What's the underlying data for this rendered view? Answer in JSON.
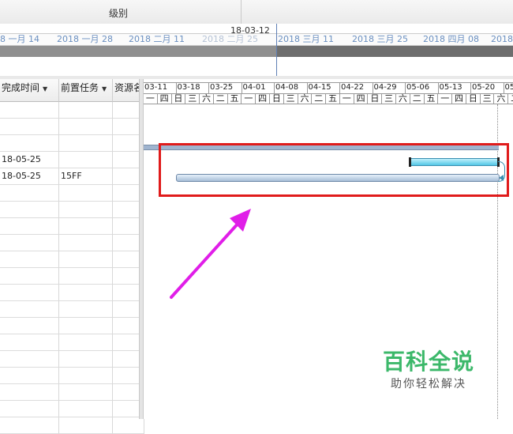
{
  "top": {
    "level_label": "级别"
  },
  "timeline": {
    "current_date": "18-03-12",
    "scale_labels": [
      {
        "text": "8 一月 14",
        "faded": false
      },
      {
        "text": "2018 一月 28",
        "faded": false
      },
      {
        "text": "2018 二月 11",
        "faded": false
      },
      {
        "text": "2018 二月 25",
        "faded": true
      },
      {
        "text": "2018 三月 11",
        "faded": false
      },
      {
        "text": "2018 三月 25",
        "faded": false
      },
      {
        "text": "2018 四月 08",
        "faded": false
      },
      {
        "text": "2018",
        "faded": false
      }
    ]
  },
  "grid": {
    "columns": [
      {
        "label": "完成时间",
        "dropdown": true
      },
      {
        "label": "前置任务",
        "dropdown": true
      },
      {
        "label": "资源名",
        "dropdown": false
      }
    ],
    "rows": [
      [
        "",
        "",
        ""
      ],
      [
        "",
        "",
        ""
      ],
      [
        "",
        "",
        ""
      ],
      [
        "18-05-25",
        "",
        ""
      ],
      [
        "18-05-25",
        "15FF",
        ""
      ],
      [
        "",
        "",
        ""
      ],
      [
        "",
        "",
        ""
      ],
      [
        "",
        "",
        ""
      ],
      [
        "",
        "",
        ""
      ],
      [
        "",
        "",
        ""
      ],
      [
        "",
        "",
        ""
      ],
      [
        "",
        "",
        ""
      ],
      [
        "",
        "",
        ""
      ],
      [
        "",
        "",
        ""
      ],
      [
        "",
        "",
        ""
      ],
      [
        "",
        "",
        ""
      ],
      [
        "",
        "",
        ""
      ],
      [
        "",
        "",
        ""
      ],
      [
        "",
        "",
        ""
      ],
      [
        "",
        "",
        ""
      ]
    ]
  },
  "gantt": {
    "weeks": [
      "03-11",
      "03-18",
      "03-25",
      "04-01",
      "04-08",
      "04-15",
      "04-22",
      "04-29",
      "05-06",
      "05-13",
      "05-20",
      "05"
    ],
    "days": [
      "一",
      "四",
      "日",
      "三",
      "六",
      "二",
      "五",
      "一",
      "四",
      "日",
      "三",
      "六",
      "二",
      "五",
      "一",
      "四",
      "日",
      "三",
      "六",
      "二",
      "五",
      "一",
      "四",
      "日",
      "三",
      "六",
      "二"
    ]
  },
  "watermark": {
    "title": "百科全说",
    "subtitle": "助你轻松解决"
  },
  "colors": {
    "highlight_box": "#e01b1b",
    "arrow": "#e01ee8",
    "task_bar": "#53c8e6",
    "watermark": "#3cb86a"
  }
}
